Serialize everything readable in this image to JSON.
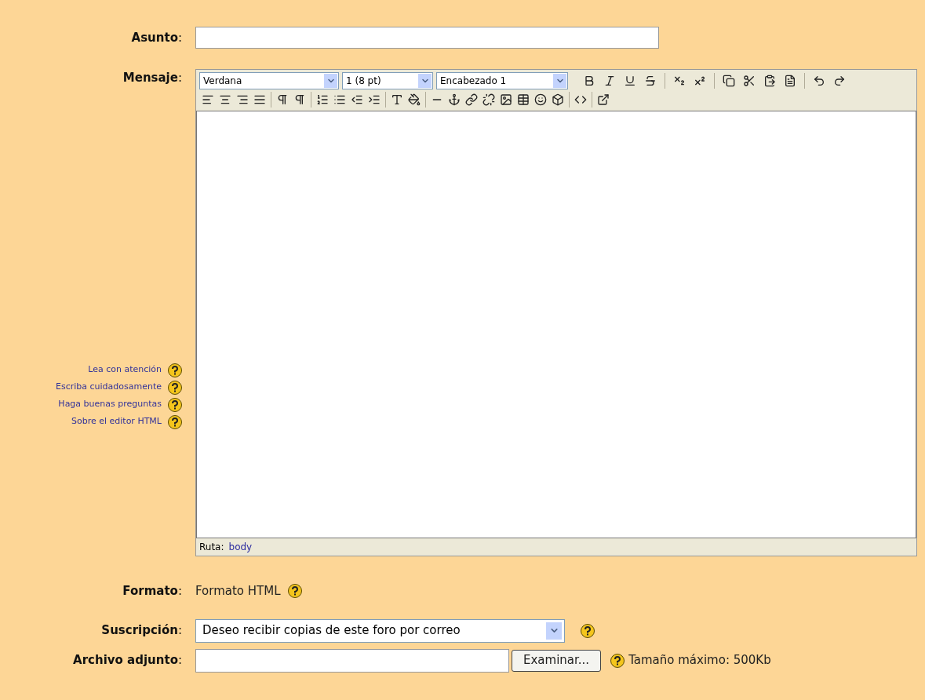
{
  "subject": {
    "label": "**Asunto**:"
  },
  "message": {
    "label": "**Mensaje**:",
    "selects": [
      {
        "value": "Verdana"
      },
      {
        "value": "1 (8 pt)"
      },
      {
        "value": "Encabezado 1"
      }
    ],
    "path_label": "Ruta:",
    "path": "body"
  },
  "help_links": [
    "Lea con atención",
    "Escriba cuidadosamente",
    "Haga buenas preguntas",
    "Sobre el editor HTML"
  ],
  "format": {
    "label": "**Formato**:",
    "value": "Formato HTML"
  },
  "subscription": {
    "label": "**Suscripción**:",
    "value": "Deseo recibir copias de este foro por correo"
  },
  "attachment": {
    "label": "**Archivo adjunto**:",
    "button": "Examinar...",
    "note": "Tamaño máximo: 500Kb"
  }
}
